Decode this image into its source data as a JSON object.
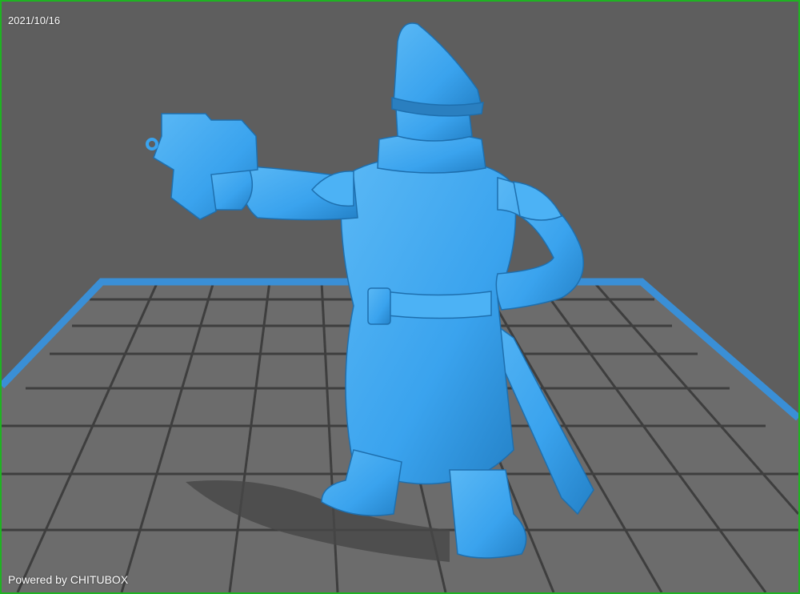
{
  "viewer": {
    "date": "2021/10/16",
    "powered_by": "Powered by CHITUBOX"
  },
  "colors": {
    "background": "#5e5e5e",
    "grid": "#6c6c6c",
    "grid_line": "#3e3e3e",
    "plate_border": "#3a8fd6",
    "model": "#3aa3ee",
    "model_shadow": "#2a7fc0",
    "frame_border": "#1fb322"
  },
  "scene": {
    "model_description": "3D miniature model of officer with pistol",
    "grid_cells": "10x6"
  }
}
